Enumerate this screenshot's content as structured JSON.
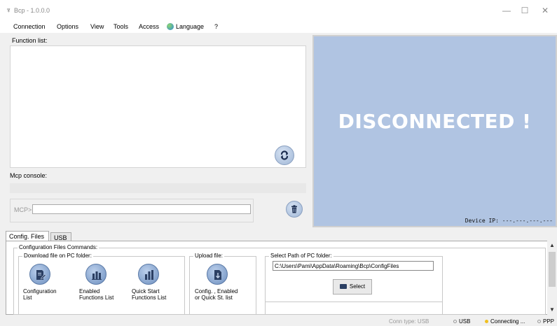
{
  "window": {
    "title": "Bcp - 1.0.0.0",
    "minimize_glyph": "—",
    "maximize_glyph": "☐",
    "close_glyph": "✕"
  },
  "menu": {
    "items": [
      "Connection",
      "Options",
      "View",
      "Tools",
      "Access",
      "Language",
      "?"
    ]
  },
  "function_panel": {
    "label": "Function list:",
    "console_label": "Mcp console:",
    "mcp_prompt": "MCP>",
    "mcp_input_value": ""
  },
  "status_panel": {
    "headline": "DISCONNECTED !",
    "device_ip": "Device IP: ---.---.---.---",
    "background_color": "#b0c4e2"
  },
  "tabs": [
    {
      "label": "Config. Files",
      "active": true
    },
    {
      "label": "USB",
      "active": false
    }
  ],
  "config_files": {
    "group_label": "Configuration Files Commands:",
    "download_label": "Download file on PC folder:",
    "upload_label": "Upload file:",
    "path_label": "Select Path of PC folder:",
    "path_value": "C:\\Users\\Pami\\AppData\\Roaming\\Bcp\\ConfigFiles",
    "select_label": "Select",
    "buttons": [
      {
        "line1": "Configuration",
        "line2": "List",
        "icon": "edit-document-icon"
      },
      {
        "line1": "Enabled",
        "line2": "Functions List",
        "icon": "bar-chart-icon"
      },
      {
        "line1": "Quick Start",
        "line2": "Functions List",
        "icon": "column-chart-icon"
      },
      {
        "line1": "Config. , Enabled",
        "line2": "or Quick St. list",
        "icon": "upload-document-icon"
      }
    ]
  },
  "statusbar": {
    "conn_type": "Conn type: USB",
    "usb": "USB",
    "connecting": "Connecting ...",
    "ppp": "PPP",
    "connecting_color": "#f0c020"
  }
}
